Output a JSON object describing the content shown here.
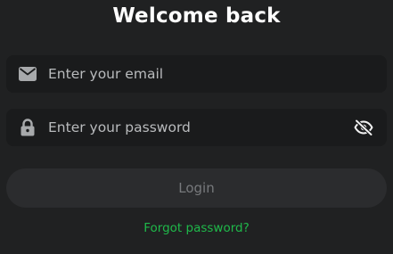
{
  "header": {
    "title": "Welcome back"
  },
  "form": {
    "email": {
      "placeholder": "Enter your email",
      "value": "",
      "icon": "envelope-icon"
    },
    "password": {
      "placeholder": "Enter your password",
      "value": "",
      "icon": "lock-icon",
      "toggle_icon": "eye-slash-icon"
    },
    "login_label": "Login",
    "forgot_label": "Forgot password?"
  },
  "colors": {
    "background": "#202122",
    "field_background": "#1a1b1c",
    "button_background": "#2b2c2e",
    "link": "#1fb94a"
  }
}
